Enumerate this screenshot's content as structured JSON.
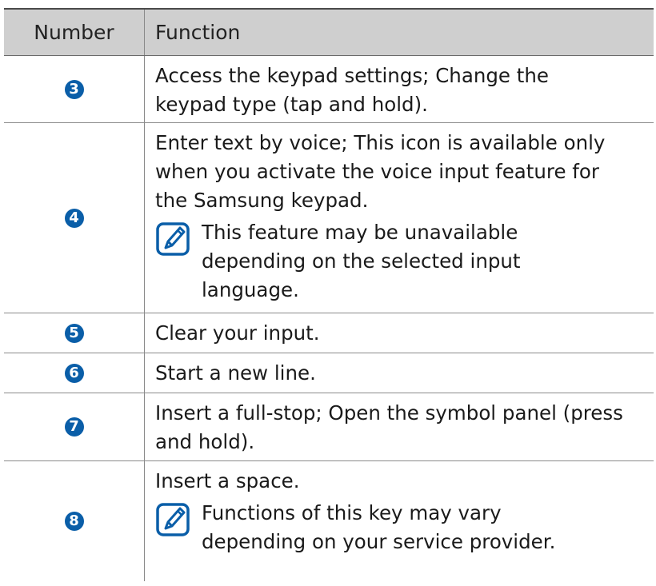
{
  "table": {
    "headers": {
      "number": "Number",
      "function": "Function"
    },
    "rows": [
      {
        "number": "3",
        "lines": [
          "Access the keypad settings; Change the",
          "keypad type (tap and hold)."
        ],
        "note": null
      },
      {
        "number": "4",
        "lines": [
          "Enter text by voice; This icon is available only",
          "when you activate the voice input feature for",
          "the Samsung keypad."
        ],
        "note": [
          "This feature may be unavailable",
          "depending on the selected input",
          "language."
        ]
      },
      {
        "number": "5",
        "lines": [
          "Clear your input."
        ],
        "note": null
      },
      {
        "number": "6",
        "lines": [
          "Start a new line."
        ],
        "note": null
      },
      {
        "number": "7",
        "lines": [
          "Insert a full-stop; Open the symbol panel (press",
          "and hold)."
        ],
        "note": null
      },
      {
        "number": "8",
        "lines": [
          "Insert a space."
        ],
        "note": [
          "Functions of this key may vary",
          "depending on your service provider."
        ]
      }
    ]
  },
  "colors": {
    "badge": "#0a5ea8",
    "header_bg": "#cfcfcf",
    "note_icon": "#0a5ea8"
  },
  "icons": {
    "note": "note-pencil-icon"
  }
}
